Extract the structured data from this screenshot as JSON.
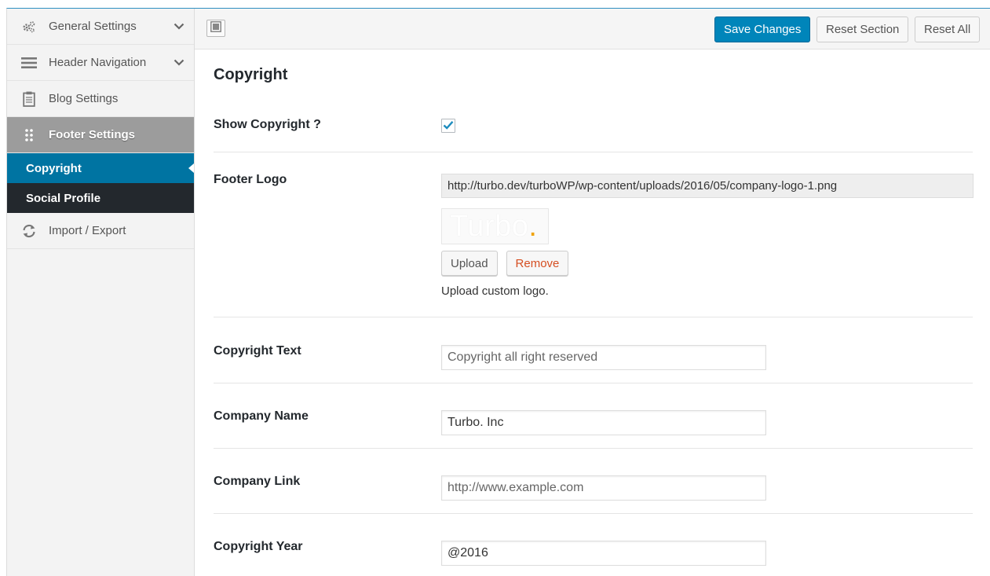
{
  "sidebar": {
    "items": [
      {
        "label": "General Settings",
        "icon": "gears-icon"
      },
      {
        "label": "Header Navigation",
        "icon": "menu-icon"
      },
      {
        "label": "Blog Settings",
        "icon": "clipboard-icon"
      },
      {
        "label": "Footer Settings",
        "icon": "grip-dots-icon"
      },
      {
        "label": "Import / Export",
        "icon": "refresh-icon"
      }
    ],
    "subitems": [
      {
        "label": "Copyright"
      },
      {
        "label": "Social Profile"
      }
    ]
  },
  "toolbar": {
    "save_label": "Save Changes",
    "reset_section_label": "Reset Section",
    "reset_all_label": "Reset All"
  },
  "main": {
    "section_title": "Copyright",
    "show_copyright": {
      "label": "Show Copyright ?",
      "checked": true
    },
    "footer_logo": {
      "label": "Footer Logo",
      "url": "http://turbo.dev/turboWP/wp-content/uploads/2016/05/company-logo-1.png",
      "preview_text": "Turbo",
      "preview_dot": ".",
      "upload_label": "Upload",
      "remove_label": "Remove",
      "help": "Upload custom logo."
    },
    "copyright_text": {
      "label": "Copyright Text",
      "placeholder": "Copyright all right reserved"
    },
    "company_name": {
      "label": "Company Name",
      "value": "Turbo. Inc"
    },
    "company_link": {
      "label": "Company Link",
      "placeholder": "http://www.example.com"
    },
    "copyright_year": {
      "label": "Copyright Year",
      "value": "@2016"
    }
  },
  "colors": {
    "accent": "#0085ba",
    "sidebar_active": "#9c9c9c",
    "submenu_current": "#0074a2",
    "submenu_bg": "#23282d",
    "remove_text": "#d54e21"
  }
}
